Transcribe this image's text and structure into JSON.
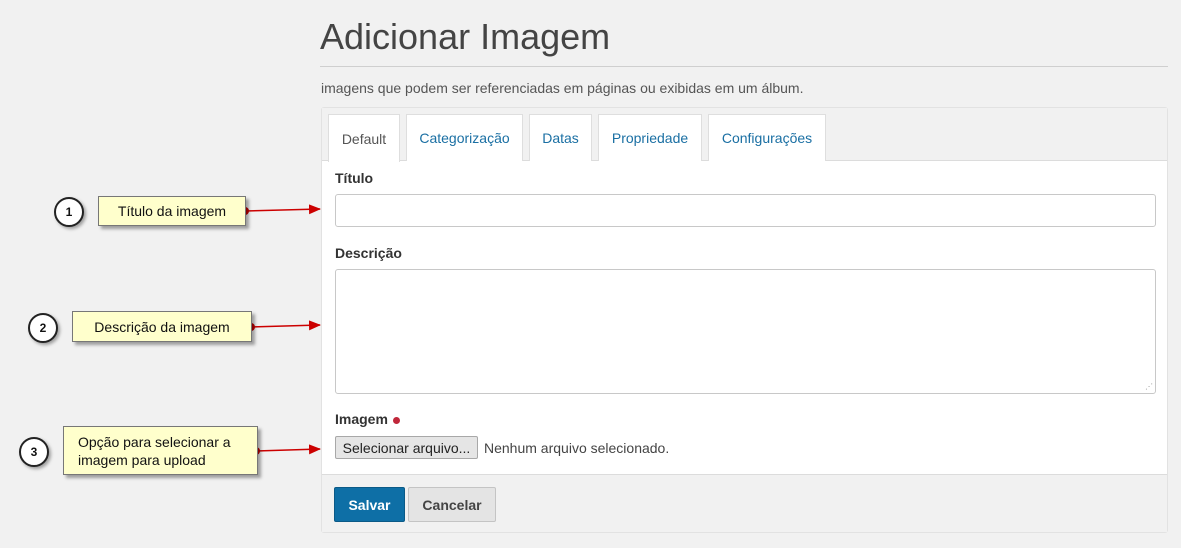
{
  "page": {
    "title": "Adicionar Imagem",
    "subtitle": "imagens que podem ser referenciadas em páginas ou exibidas em um álbum."
  },
  "tabs": [
    {
      "label": "Default",
      "active": true
    },
    {
      "label": "Categorização",
      "active": false
    },
    {
      "label": "Datas",
      "active": false
    },
    {
      "label": "Propriedade",
      "active": false
    },
    {
      "label": "Configurações",
      "active": false
    }
  ],
  "form": {
    "title_label": "Título",
    "title_value": "",
    "description_label": "Descrição",
    "description_value": "",
    "image_label": "Imagem",
    "file_button_label": "Selecionar arquivo...",
    "file_status": "Nenhum arquivo selecionado."
  },
  "actions": {
    "save_label": "Salvar",
    "cancel_label": "Cancelar"
  },
  "callouts": [
    {
      "number": "1",
      "text": "Título da imagem"
    },
    {
      "number": "2",
      "text": "Descrição da imagem"
    },
    {
      "number": "3",
      "text": "Opção para selecionar a imagem para upload"
    }
  ],
  "colors": {
    "accent": "#0e6fa6",
    "link": "#1a6fa3",
    "required": "#c0273a",
    "callout_bg": "#ffffcc",
    "arrow": "#cc0000"
  }
}
